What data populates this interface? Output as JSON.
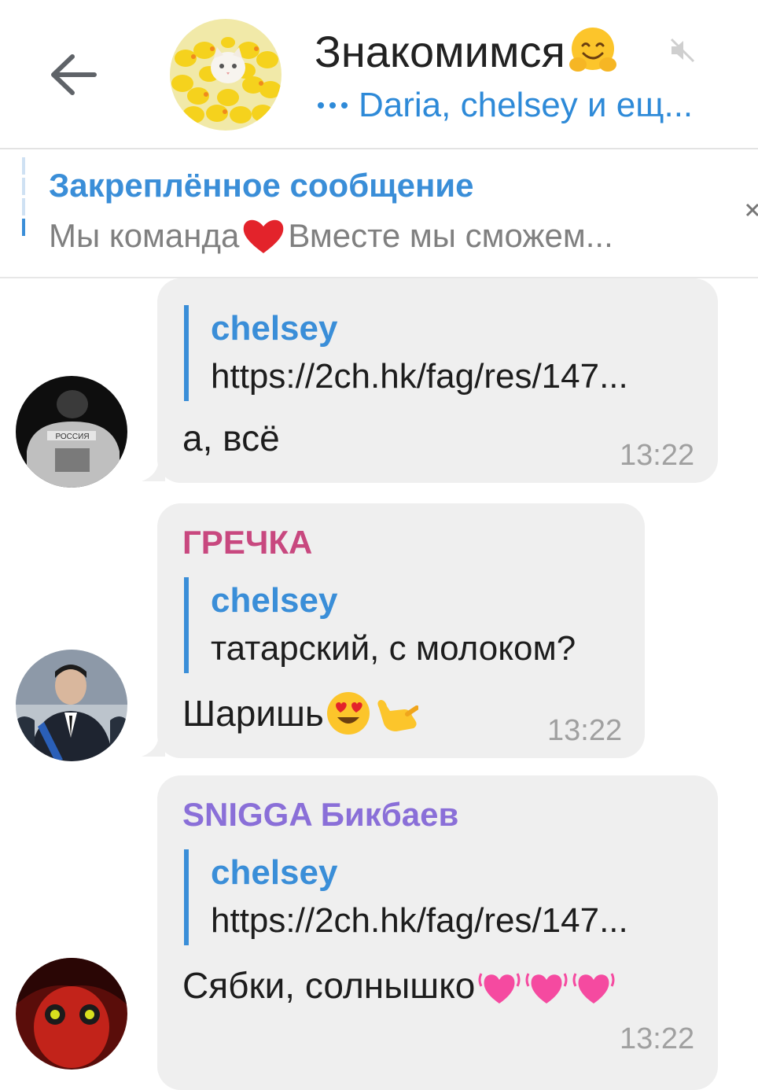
{
  "header": {
    "title": "Знакомимся",
    "title_emoji": "hugging-face-emoji",
    "status": "Daria, chelsey и ещ...",
    "accent_color": "#2e8ad8"
  },
  "pinned": {
    "title": "Закреплённое сообщение",
    "text_before": "Мы команда",
    "text_after": "Вместе мы сможем..."
  },
  "messages": [
    {
      "reply_name": "chelsey",
      "reply_text": "https://2ch.hk/fag/res/147...",
      "text": "а, всё",
      "time": "13:22"
    },
    {
      "sender": "ГРЕЧКА",
      "sender_color": "#c8487f",
      "reply_name": "chelsey",
      "reply_text": "татарский, с молоком?",
      "text": "Шаришь",
      "emojis": [
        "heart-eyes-emoji",
        "call-me-hand-emoji"
      ],
      "time": "13:22"
    },
    {
      "sender": "SNIGGA Бикбаев",
      "sender_color": "#8a6fd8",
      "reply_name": "chelsey",
      "reply_text": "https://2ch.hk/fag/res/147...",
      "text": "Сябки, солнышко",
      "emojis": [
        "beating-heart-emoji",
        "beating-heart-emoji",
        "beating-heart-emoji"
      ],
      "time": "13:22"
    }
  ]
}
